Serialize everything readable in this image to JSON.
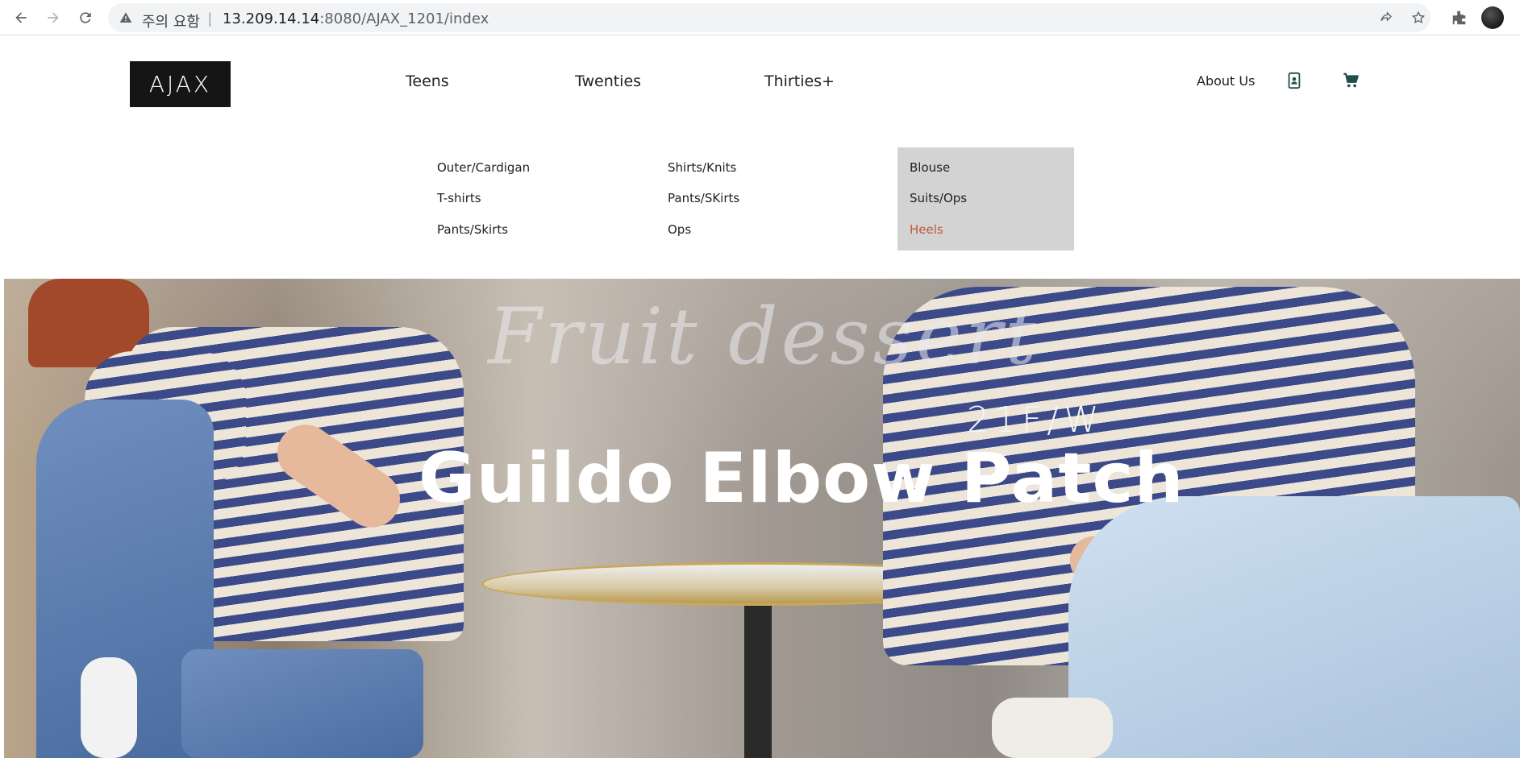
{
  "browser": {
    "security_warning": "주의 요함",
    "separator": "|",
    "url_host": "13.209.14.14",
    "url_rest": ":8080/AJAX_1201/index"
  },
  "site": {
    "logo_text": "AJAX",
    "nav": [
      "Teens",
      "Twenties",
      "Thirties+"
    ],
    "about": "About Us"
  },
  "dropdown": {
    "teens": [
      "Outer/Cardigan",
      "T-shirts",
      "Pants/Skirts"
    ],
    "twenties": [
      "Shirts/Knits",
      "Pants/SKirts",
      "Ops"
    ],
    "thirties": [
      "Blouse",
      "Suits/Ops",
      "Heels"
    ],
    "highlight_color": "#c0583a"
  },
  "hero": {
    "script_text": "Fruit dessert",
    "season": "21F/W",
    "headline": "Guildo Elbow Patch"
  }
}
